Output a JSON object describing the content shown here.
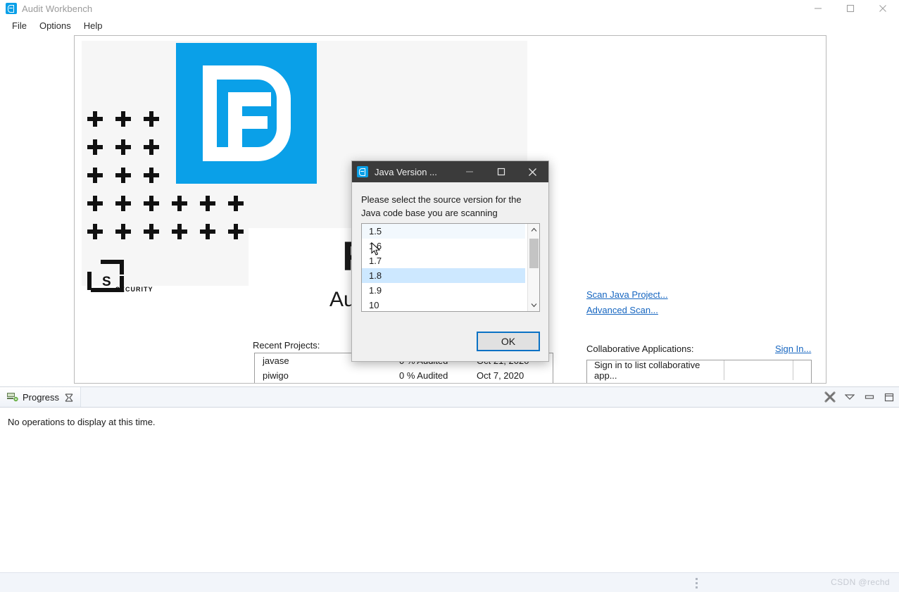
{
  "window": {
    "title": "Audit Workbench",
    "icon": "fortify-app-icon",
    "controls": [
      {
        "name": "minimize-button",
        "glyph": "minimize"
      },
      {
        "name": "maximize-button",
        "glyph": "maximize"
      },
      {
        "name": "close-button",
        "glyph": "close"
      }
    ]
  },
  "menubar": {
    "items": [
      {
        "label": "File"
      },
      {
        "label": "Options"
      },
      {
        "label": "Help"
      }
    ]
  },
  "welcome": {
    "brand_initial": "F",
    "product_title": "Au",
    "security_label": "SECURITY",
    "recent_projects_label": "Recent Projects:",
    "recent_projects": [
      {
        "name": "javase",
        "audited": "0 % Audited",
        "date": "Oct 21, 2020"
      },
      {
        "name": "piwigo",
        "audited": "0 % Audited",
        "date": "Oct 7, 2020"
      }
    ],
    "links": [
      {
        "name": "scan-java-project-link",
        "label": "Scan Java Project..."
      },
      {
        "name": "advanced-scan-link",
        "label": "Advanced Scan..."
      }
    ],
    "partial_link": "...",
    "collaborative_label": "Collaborative Applications:",
    "sign_in_link": "Sign In...",
    "collaborative_rows": [
      {
        "text": "Sign in to list collaborative app..."
      }
    ]
  },
  "progress_view": {
    "tab_label": "Progress",
    "tab_icon": "progress-icon",
    "close_icon": "close-view-icon",
    "message": "No operations to display at this time.",
    "tools": [
      {
        "name": "kill-all-jobs-icon",
        "glyph": "kill"
      },
      {
        "name": "view-menu-icon",
        "glyph": "chevron-down"
      },
      {
        "name": "minimize-view-icon",
        "glyph": "minimize"
      },
      {
        "name": "maximize-view-icon",
        "glyph": "maximize"
      }
    ]
  },
  "statusbar": {
    "grip": "resize-grip",
    "watermark": "CSDN @rechd"
  },
  "dialog": {
    "title": "Java Version ...",
    "icon": "fortify-dialog-icon",
    "prompt": "Please select the source version for the Java code base you are scanning",
    "controls": [
      {
        "name": "dialog-minimize-button",
        "glyph": "minimize"
      },
      {
        "name": "dialog-maximize-button",
        "glyph": "maximize"
      },
      {
        "name": "dialog-close-button",
        "glyph": "close"
      }
    ],
    "options": [
      {
        "value": "1.5",
        "state": "hover-light"
      },
      {
        "value": "1.6",
        "state": "normal"
      },
      {
        "value": "1.7",
        "state": "normal"
      },
      {
        "value": "1.8",
        "state": "selected"
      },
      {
        "value": "1.9",
        "state": "normal"
      },
      {
        "value": "10",
        "state": "normal"
      }
    ],
    "selected_value": "1.8",
    "ok_label": "OK",
    "scrollbar": {
      "up": "scroll-up-arrow",
      "down": "scroll-down-arrow"
    }
  },
  "colors": {
    "brand_blue": "#0aa0e8",
    "link_blue": "#1565c0",
    "selection_blue": "#cde8ff",
    "focus_border": "#0a72c4",
    "dialog_titlebar": "#3b3b3b"
  }
}
